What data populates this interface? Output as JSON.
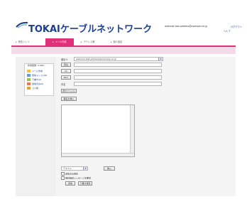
{
  "header": {
    "brand": "TOKAIケーブルネットワーク",
    "account": "webmail-test-address@example.ne.jp",
    "logout": "ログアウト",
    "help": "ヘルプ"
  },
  "nav": {
    "tabs": [
      {
        "label": "受信トレイ"
      },
      {
        "label": "メール作成"
      },
      {
        "label": "アドレス帳"
      },
      {
        "label": "個人設定"
      }
    ]
  },
  "sidebar": {
    "title": "利用容量: 0.06%",
    "folders": [
      {
        "label": "メール作成"
      },
      {
        "label": "受信トレイ(18)"
      },
      {
        "label": "下書き(0)"
      },
      {
        "label": "送信済み(0)"
      },
      {
        "label": "ゴミ箱"
      }
    ]
  },
  "compose": {
    "from_label": "差出人",
    "from_value": "webmail-test-address@example.ne.jp",
    "to_button": "宛先",
    "cc_button": "CC",
    "bcc_button": "BCC",
    "subject_label": "件名",
    "attach_button": "添付ファイル",
    "signature_button": "署名を挿入",
    "font_select": "テキスト",
    "insert_button": "挿入",
    "check_save_copy": "送信済み保存",
    "check_request_receipt": "開封確認メッセージを要求",
    "send_button": "送信",
    "draft_button": "下書き保存"
  },
  "colors": {
    "accent": "#e0307a",
    "brand_blue": "#1a3f8f",
    "subbar": "#f3dbe7"
  }
}
